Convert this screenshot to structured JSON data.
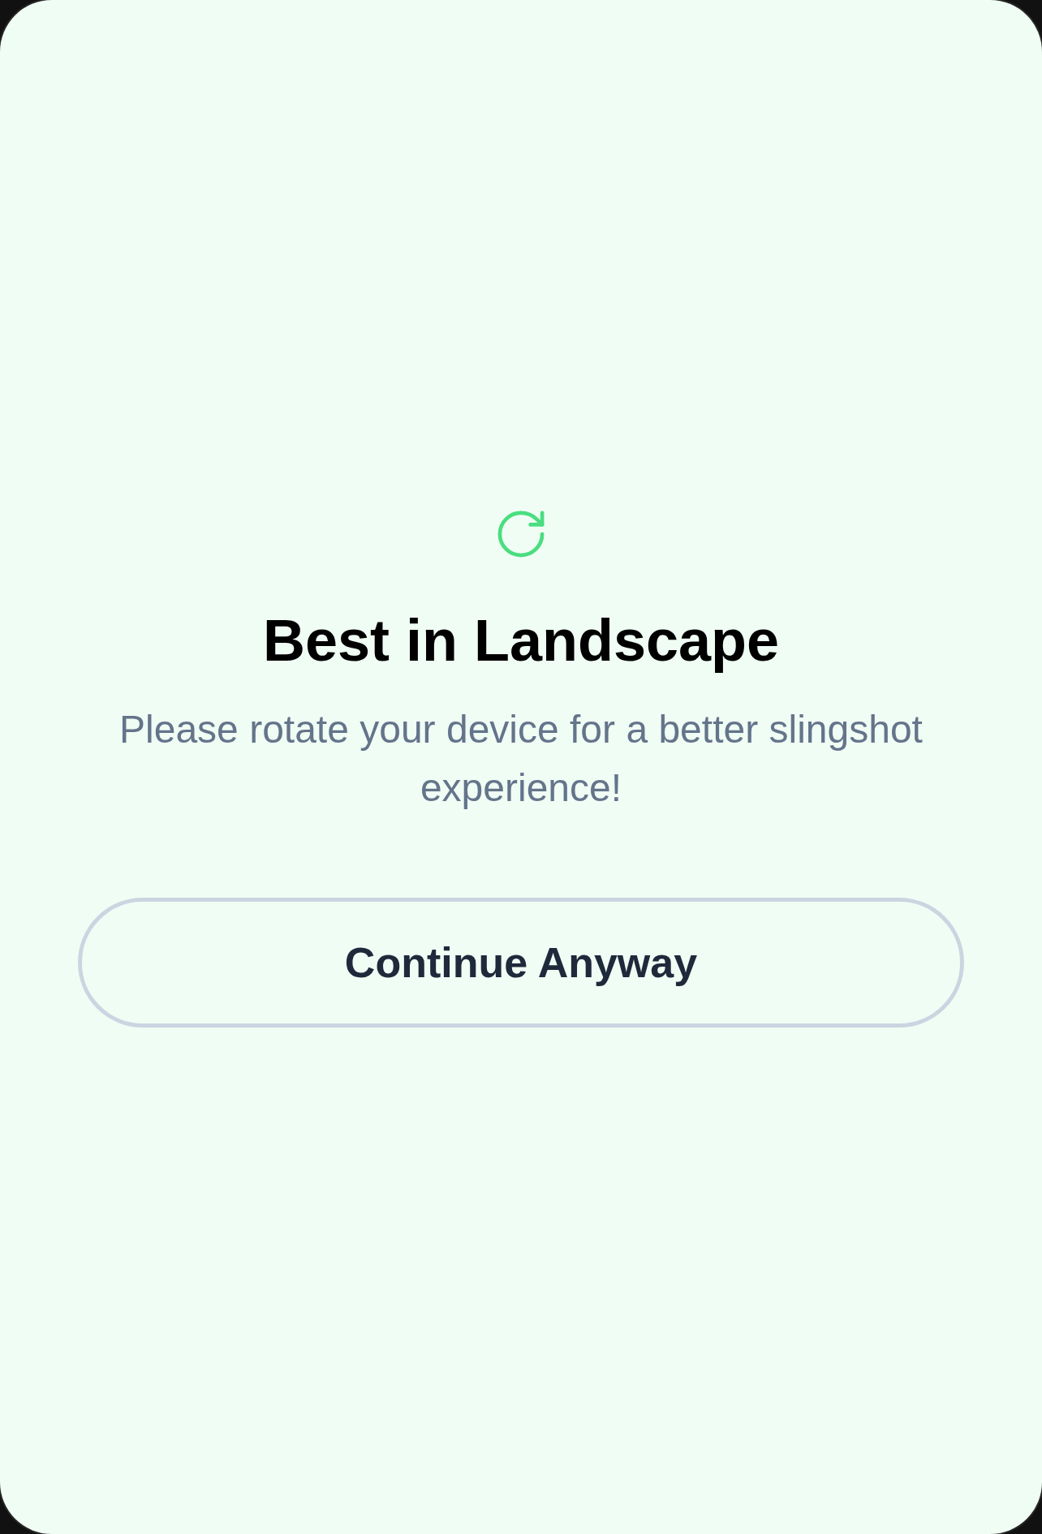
{
  "prompt": {
    "title": "Best in Landscape",
    "message": "Please rotate your device for a better slingshot experience!"
  },
  "button": {
    "label": "Continue Anyway"
  }
}
